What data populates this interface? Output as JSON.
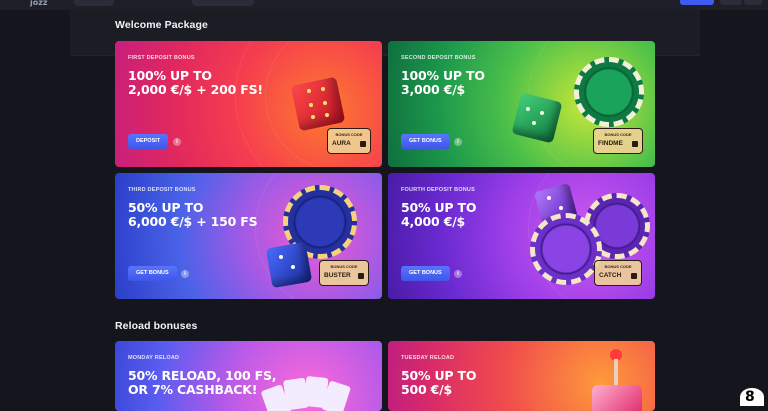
{
  "header": {
    "logo": "jozz"
  },
  "sections": {
    "welcome": "Welcome Package",
    "reload": "Reload bonuses"
  },
  "cards": [
    {
      "kicker": "FIRST DEPOSIT BONUS",
      "headline": "100% UP TO\n2,000 €/$ + 200 FS!",
      "button": "DEPOSIT",
      "code_label": "BONUS CODE",
      "code": "AURA"
    },
    {
      "kicker": "SECOND DEPOSIT BONUS",
      "headline": "100% UP TO\n3,000 €/$",
      "button": "GET BONUS",
      "code_label": "BONUS CODE",
      "code": "FINDME"
    },
    {
      "kicker": "THIRD DEPOSIT BONUS",
      "headline": "50% UP TO\n6,000 €/$ + 150 FS",
      "button": "GET BONUS",
      "code_label": "BONUS CODE",
      "code": "BUSTER"
    },
    {
      "kicker": "FOURTH DEPOSIT BONUS",
      "headline": "50% UP TO\n4,000 €/$",
      "button": "GET BONUS",
      "code_label": "BONUS CODE",
      "code": "CATCH"
    },
    {
      "kicker": "MONDAY RELOAD",
      "headline": "50% RELOAD, 100 FS,\nOR 7% CASHBACK!"
    },
    {
      "kicker": "TUESDAY RELOAD",
      "headline": "50% UP TO\n500 €/$"
    }
  ],
  "info_glyph": "i",
  "chat_glyph": "8",
  "colors": {
    "button": "#4a63f5",
    "background": "#15161d"
  }
}
